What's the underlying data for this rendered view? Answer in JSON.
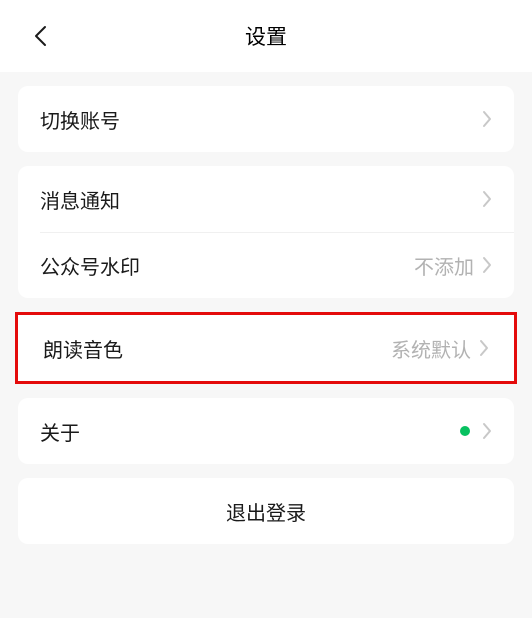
{
  "header": {
    "title": "设置"
  },
  "rows": {
    "switch_account": "切换账号",
    "notifications": "消息通知",
    "watermark": {
      "label": "公众号水印",
      "value": "不添加"
    },
    "voice": {
      "label": "朗读音色",
      "value": "系统默认"
    },
    "about": "关于"
  },
  "logout": "退出登录"
}
